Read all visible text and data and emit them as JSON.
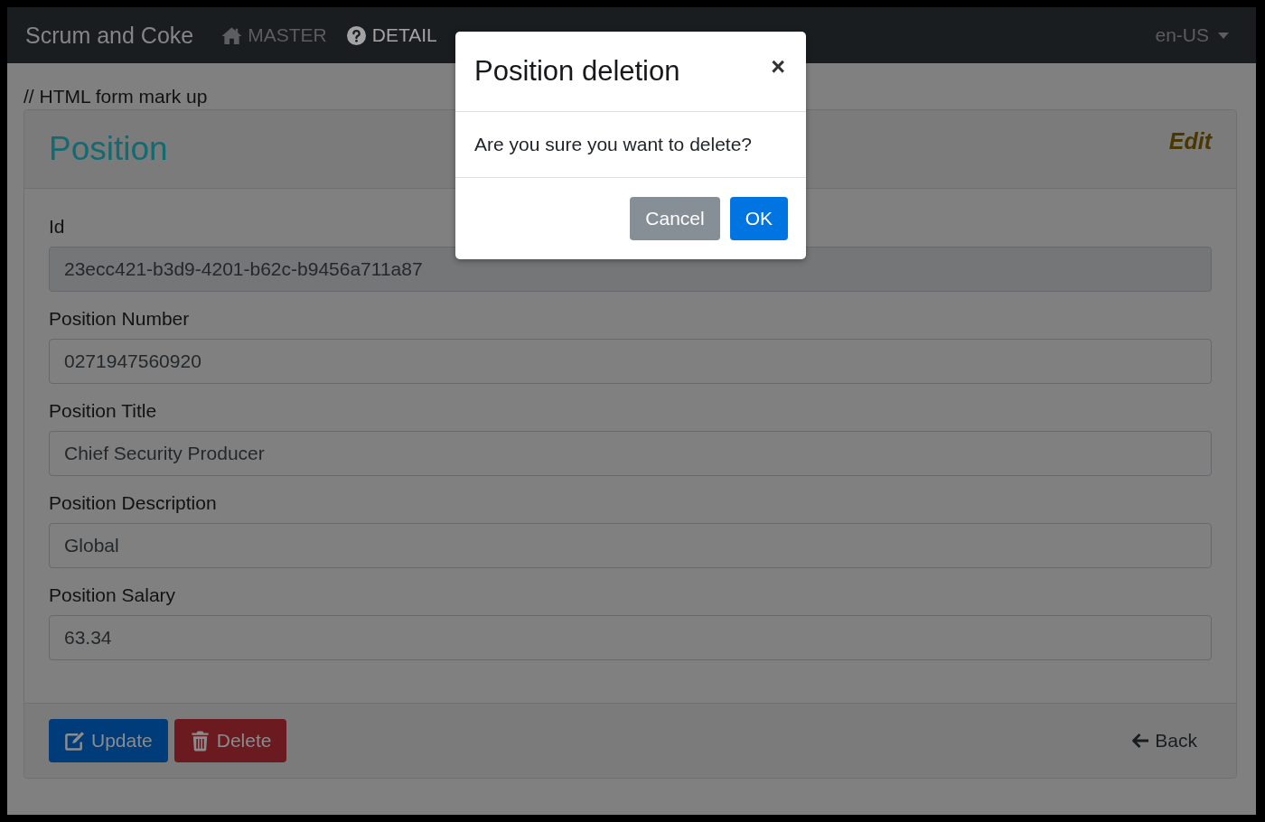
{
  "navbar": {
    "brand": "Scrum and Coke",
    "items": [
      {
        "label": "MASTER",
        "selected": false
      },
      {
        "label": "DETAIL",
        "selected": true
      }
    ],
    "language": "en-US"
  },
  "page": {
    "comment": "// HTML form mark up"
  },
  "card": {
    "title": "Position",
    "mode": "Edit",
    "fields": [
      {
        "label": "Id",
        "value": "23ecc421-b3d9-4201-b62c-b9456a711a87",
        "disabled": true
      },
      {
        "label": "Position Number",
        "value": "0271947560920",
        "disabled": false
      },
      {
        "label": "Position Title",
        "value": "Chief Security Producer",
        "disabled": false
      },
      {
        "label": "Position Description",
        "value": "Global",
        "disabled": false
      },
      {
        "label": "Position Salary",
        "value": "63.34",
        "disabled": false
      }
    ],
    "buttons": [
      {
        "label": "Update",
        "kind": "primary"
      },
      {
        "label": "Delete",
        "kind": "danger"
      }
    ],
    "back": "Back"
  },
  "modal": {
    "title": "Position deletion",
    "close": "×",
    "message": "Are you sure you want to delete?",
    "buttons": [
      {
        "label": "Cancel",
        "kind": "secondary"
      },
      {
        "label": "OK",
        "kind": "primary"
      }
    ]
  }
}
